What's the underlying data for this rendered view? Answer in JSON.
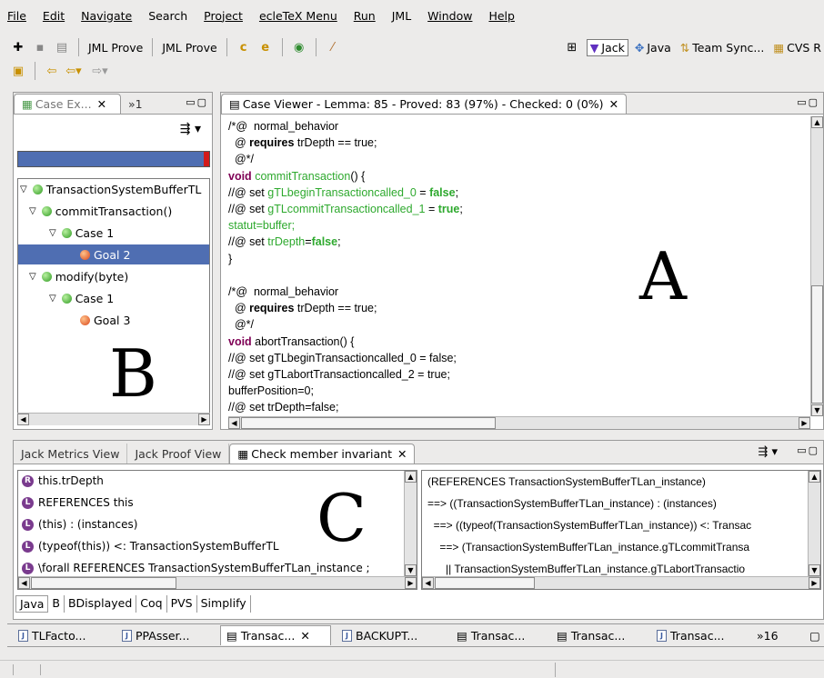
{
  "menu": [
    "File",
    "Edit",
    "Navigate",
    "Search",
    "Project",
    "ecleTeX Menu",
    "Run",
    "JML",
    "Window",
    "Help"
  ],
  "toolbar": {
    "jml_prove_1": "JML Prove",
    "jml_prove_2": "JML Prove"
  },
  "perspectives": {
    "jack": "Jack",
    "java": "Java",
    "team_sync": "Team Sync...",
    "cvs": "CVS R"
  },
  "case_explorer": {
    "tab_label": "Case Ex...",
    "overflow": "»1",
    "tree": [
      {
        "label": "TransactionSystemBufferTL",
        "level": 0,
        "status": "ok",
        "expanded": true
      },
      {
        "label": "commitTransaction()",
        "level": 1,
        "status": "ok",
        "expanded": true
      },
      {
        "label": "Case 1",
        "level": 2,
        "status": "ok",
        "expanded": true
      },
      {
        "label": "Goal 2",
        "level": 3,
        "status": "err",
        "selected": true
      },
      {
        "label": "modify(byte)",
        "level": 1,
        "status": "ok",
        "expanded": true
      },
      {
        "label": "Case 1",
        "level": 2,
        "status": "ok",
        "expanded": true
      },
      {
        "label": "Goal 3",
        "level": 3,
        "status": "err"
      }
    ],
    "overlay_letter": "B"
  },
  "case_viewer": {
    "tab_label": "Case Viewer - Lemma: 85 - Proved: 83 (97%) - Checked: 0 (0%)",
    "overlay_letter": "A"
  },
  "bottom_view": {
    "tabs": [
      "Jack Metrics View",
      "Jack Proof View",
      "Check member invariant"
    ],
    "hyps": [
      {
        "badge": "R",
        "text": "this.trDepth"
      },
      {
        "badge": "L",
        "text": "REFERENCES this"
      },
      {
        "badge": "L",
        "text": "(this) : (instances)"
      },
      {
        "badge": "L",
        "text": "(typeof(this)) <: TransactionSystemBufferTL"
      },
      {
        "badge": "L",
        "text": "\\forall REFERENCES TransactionSystemBufferTLan_instance ;"
      }
    ],
    "goal_lines": [
      "(REFERENCES TransactionSystemBufferTLan_instance)",
      "==> ((TransactionSystemBufferTLan_instance) : (instances)",
      "  ==> ((typeof(TransactionSystemBufferTLan_instance)) <: Transac",
      "    ==> (TransactionSystemBufferTLan_instance.gTLcommitTransa",
      "      || TransactionSystemBufferTLan_instance.gTLabortTransactio"
    ],
    "overlay_letter": "C",
    "prover_tabs": [
      "Java",
      "B",
      "BDisplayed",
      "Coq",
      "PVS",
      "Simplify"
    ]
  },
  "editor_tabs": [
    {
      "label": "TLFacto...",
      "icon": "J"
    },
    {
      "label": "PPAsser...",
      "icon": "J"
    },
    {
      "label": "Transac...",
      "icon": "doc",
      "active": true
    },
    {
      "label": "BACKUPT...",
      "icon": "J"
    },
    {
      "label": "Transac...",
      "icon": "doc"
    },
    {
      "label": "Transac...",
      "icon": "doc"
    },
    {
      "label": "Transac...",
      "icon": "J"
    }
  ],
  "editor_overflow": "»16"
}
